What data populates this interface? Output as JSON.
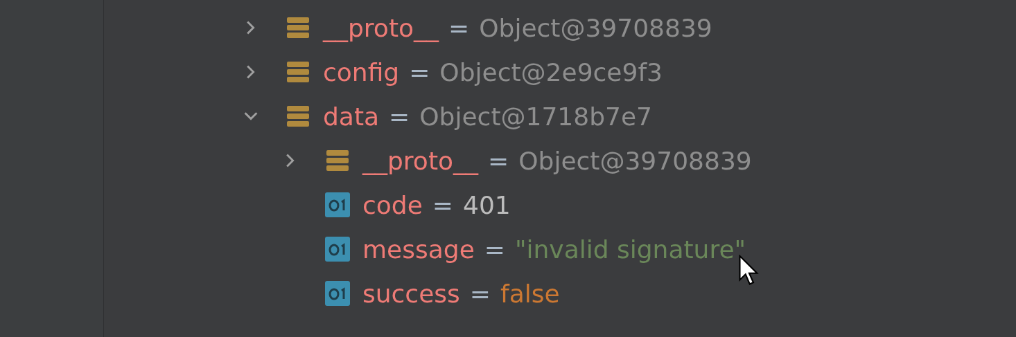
{
  "variables": [
    {
      "name": "__proto__",
      "separator": "=",
      "value": "Object@39708839",
      "kind": "object",
      "color": "#8e8e8e",
      "expanded": false
    },
    {
      "name": "config",
      "separator": "=",
      "value": "Object@2e9ce9f3",
      "kind": "object",
      "color": "#8e8e8e",
      "expanded": false
    },
    {
      "name": "data",
      "separator": "=",
      "value": "Object@1718b7e7",
      "kind": "object",
      "color": "#8e8e8e",
      "expanded": true,
      "children": [
        {
          "name": "__proto__",
          "separator": "=",
          "value": "Object@39708839",
          "kind": "object",
          "color": "#8e8e8e",
          "expanded": false
        },
        {
          "name": "code",
          "separator": "=",
          "value": "401",
          "kind": "primitive",
          "color": "#bcbcbc"
        },
        {
          "name": "message",
          "separator": "=",
          "value": "\"invalid signature\"",
          "kind": "primitive",
          "color": "#6a8759"
        },
        {
          "name": "success",
          "separator": "=",
          "value": "false",
          "kind": "primitive",
          "color": "#cc7832"
        }
      ]
    }
  ]
}
